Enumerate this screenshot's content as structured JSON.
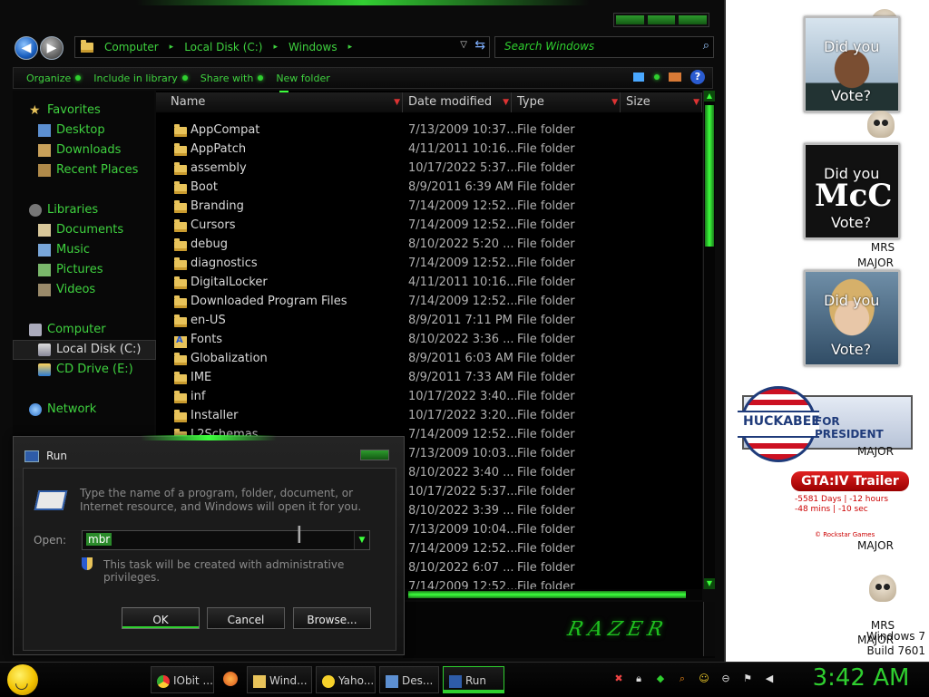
{
  "explorer": {
    "address": {
      "crumbs": [
        "Computer",
        "Local Disk (C:)",
        "Windows"
      ]
    },
    "search": {
      "placeholder": "Search Windows"
    },
    "toolbar": {
      "organize": "Organize",
      "include_library": "Include in library",
      "share_with": "Share with",
      "new_folder": "New folder"
    },
    "nav": {
      "favorites": "Favorites",
      "desktop": "Desktop",
      "downloads": "Downloads",
      "recent_places": "Recent Places",
      "libraries": "Libraries",
      "documents": "Documents",
      "music": "Music",
      "pictures": "Pictures",
      "videos": "Videos",
      "computer": "Computer",
      "local_disk": "Local Disk (C:)",
      "cd_drive": "CD Drive (E:)",
      "network": "Network"
    },
    "columns": {
      "name": "Name",
      "date_modified": "Date modified",
      "type": "Type",
      "size": "Size"
    },
    "files": [
      {
        "name": "AppCompat",
        "date": "7/13/2009 10:37...",
        "type": "File folder"
      },
      {
        "name": "AppPatch",
        "date": "4/11/2011 10:16...",
        "type": "File folder"
      },
      {
        "name": "assembly",
        "date": "10/17/2022 5:37...",
        "type": "File folder"
      },
      {
        "name": "Boot",
        "date": "8/9/2011 6:39 AM",
        "type": "File folder"
      },
      {
        "name": "Branding",
        "date": "7/14/2009 12:52...",
        "type": "File folder"
      },
      {
        "name": "Cursors",
        "date": "7/14/2009 12:52...",
        "type": "File folder"
      },
      {
        "name": "debug",
        "date": "8/10/2022 5:20 ...",
        "type": "File folder"
      },
      {
        "name": "diagnostics",
        "date": "7/14/2009 12:52...",
        "type": "File folder"
      },
      {
        "name": "DigitalLocker",
        "date": "4/11/2011 10:16...",
        "type": "File folder"
      },
      {
        "name": "Downloaded Program Files",
        "date": "7/14/2009 12:52...",
        "type": "File folder"
      },
      {
        "name": "en-US",
        "date": "8/9/2011 7:11 PM",
        "type": "File folder"
      },
      {
        "name": "Fonts",
        "date": "8/10/2022 3:36 ...",
        "type": "File folder"
      },
      {
        "name": "Globalization",
        "date": "8/9/2011 6:03 AM",
        "type": "File folder"
      },
      {
        "name": "IME",
        "date": "8/9/2011 7:33 AM",
        "type": "File folder"
      },
      {
        "name": "inf",
        "date": "10/17/2022 3:40...",
        "type": "File folder"
      },
      {
        "name": "Installer",
        "date": "10/17/2022 3:20...",
        "type": "File folder"
      },
      {
        "name": "L2Schemas",
        "date": "7/14/2009 12:52...",
        "type": "File folder"
      },
      {
        "name": "",
        "date": "7/13/2009 10:03...",
        "type": "File folder"
      },
      {
        "name": "",
        "date": "8/10/2022 3:40 ...",
        "type": "File folder"
      },
      {
        "name": "",
        "date": "10/17/2022 5:37...",
        "type": "File folder"
      },
      {
        "name": "",
        "date": "8/10/2022 3:39 ...",
        "type": "File folder"
      },
      {
        "name": "",
        "date": "7/13/2009 10:04...",
        "type": "File folder"
      },
      {
        "name": "",
        "date": "7/14/2009 12:52...",
        "type": "File folder"
      },
      {
        "name": "",
        "date": "8/10/2022 6:07 ...",
        "type": "File folder"
      },
      {
        "name": "",
        "date": "7/14/2009 12:52...",
        "type": "File folder"
      }
    ],
    "logo": "RAZER"
  },
  "run_dialog": {
    "title": "Run",
    "description": "Type the name of a program, folder, document, or Internet resource, and Windows will open it for you.",
    "open_label": "Open:",
    "open_value": "mbr",
    "admin_note": "This task will be created with administrative privileges.",
    "ok": "OK",
    "cancel": "Cancel",
    "browse": "Browse..."
  },
  "gadgets": {
    "vote_question": "Did you",
    "vote_prompt": "Vote?",
    "mccain_text": "McC",
    "caption_mrs": "MRS",
    "caption_major": "MAJOR",
    "huckabee_name": "HUCKABEE",
    "huckabee_sub": "FOR PRESIDENT",
    "gta_title": "GTA:IV Trailer",
    "gta_line1": "-5581 Days | -12 hours",
    "gta_line2": "-48 mins | -10 sec",
    "gta_credit": "© Rockstar Games",
    "windows_version": "Windows 7",
    "build": "Build 7601"
  },
  "taskbar": {
    "items": [
      {
        "label": "IObit ..."
      },
      {
        "label": "Wind..."
      },
      {
        "label": "Yaho..."
      },
      {
        "label": "Des..."
      },
      {
        "label": "Run"
      }
    ],
    "clock": "3:42 AM"
  },
  "colors": {
    "accent": "#2fcf2f",
    "background": "#0b0b0b"
  }
}
